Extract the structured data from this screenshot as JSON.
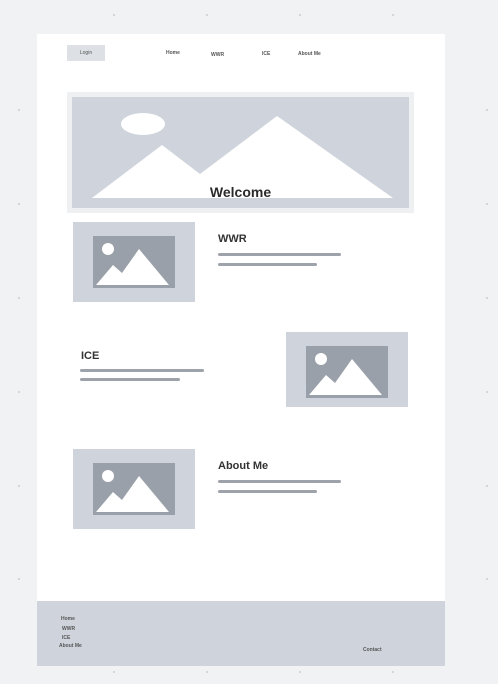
{
  "header": {
    "login_label": "Login",
    "nav": [
      {
        "label": "Home"
      },
      {
        "label": "WWR"
      },
      {
        "label": "ICE"
      },
      {
        "label": "About Me"
      }
    ]
  },
  "hero": {
    "title": "Welcome"
  },
  "sections": [
    {
      "title": "WWR"
    },
    {
      "title": "ICE"
    },
    {
      "title": "About Me"
    }
  ],
  "footer": {
    "links": [
      {
        "label": "Home"
      },
      {
        "label": "WWR"
      },
      {
        "label": "ICE"
      },
      {
        "label": "About Me"
      }
    ],
    "contact_label": "Contact"
  },
  "colors": {
    "canvas": "#f1f2f4",
    "placeholder": "#cfd4dc",
    "placeholder_dark": "#9aa0a9",
    "text_line": "#9ea3ab"
  },
  "icons": {
    "hero": "image-placeholder-icon",
    "card": "image-placeholder-icon"
  }
}
